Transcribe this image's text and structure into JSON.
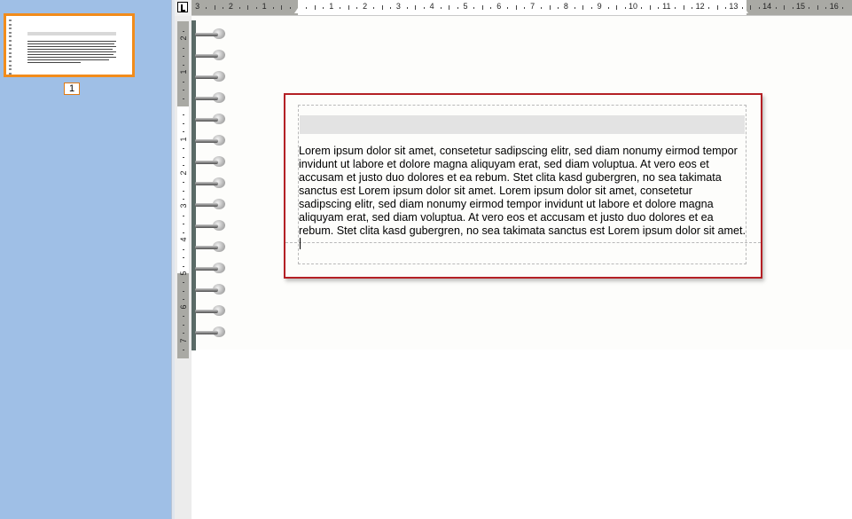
{
  "thumbnails": [
    {
      "page_number": "1",
      "selected": true
    }
  ],
  "ruler": {
    "horizontal_labels": [
      "3",
      "2",
      "1",
      "1",
      "2",
      "3",
      "4",
      "5",
      "6",
      "7",
      "8",
      "9",
      "10",
      "11",
      "12",
      "13",
      "14",
      "15",
      "16"
    ],
    "vertical_labels": [
      "2",
      "1",
      "1",
      "2",
      "3",
      "4",
      "5",
      "6",
      "7"
    ]
  },
  "document": {
    "heading": "",
    "body": "Lorem ipsum dolor sit amet, consetetur sadipscing elitr, sed diam nonumy eirmod tempor invidunt ut labore et dolore magna aliquyam erat, sed diam voluptua. At vero eos et accusam et justo duo dolores et ea rebum. Stet clita kasd gubergren, no sea takimata sanctus est Lorem ipsum dolor sit amet. Lorem ipsum dolor sit amet, consetetur sadipscing elitr, sed diam nonumy eirmod tempor invidunt ut labore et dolore magna aliquyam erat, sed diam voluptua. At vero eos et accusam et justo duo dolores et ea rebum. Stet clita kasd gubergren, no sea takimata sanctus est Lorem ipsum dolor sit amet."
  },
  "colors": {
    "thumbnail_pane": "#9fbfe6",
    "thumbnail_selection": "#f28c1c",
    "frame_border": "#b42025",
    "ruler_margin": "#a9a9a4"
  }
}
